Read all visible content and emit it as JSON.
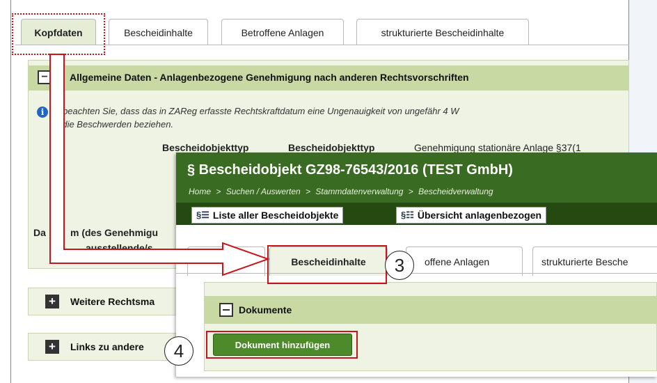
{
  "background": {
    "tabs": [
      {
        "label": "Kopfdaten",
        "active": true
      },
      {
        "label": "Bescheidinhalte",
        "active": false
      },
      {
        "label": "Betroffene Anlagen",
        "active": false
      },
      {
        "label": "strukturierte Bescheidinhalte",
        "active": false
      }
    ],
    "panel_title": "Allgemeine Daten - Anlagenbezogene Genehmigung nach anderen Rechtsvorschriften",
    "info_line1": "tte beachten Sie, dass das in ZAReg erfasste Rechtskraftdatum eine Ungenauigkeit von ungefähr 4 W",
    "info_line2": "ch die Beschwerden beziehen.",
    "field_label_1": "Bescheidobjekttyp",
    "field_label_2": "Bescheidobjekttyp",
    "field_value": "Genehmigung stationäre Anlage §37(1",
    "date_label": "m (des Genehmigu",
    "date_label_prefix": "Da",
    "issuer_label": "ausstellende/s",
    "sections": [
      {
        "label": "Weitere Rechtsma"
      },
      {
        "label": "Links zu andere"
      }
    ]
  },
  "overlay": {
    "title": "§ Bescheidobjekt GZ98-76543/2016 (TEST GmbH)",
    "breadcrumb": [
      "Home",
      ">",
      "Suchen / Auswerten",
      ">",
      "Stammdatenverwaltung",
      ">",
      "Bescheidverwaltung"
    ],
    "toolbar": [
      {
        "icon": "§☰",
        "label": "Liste aller Bescheidobjekte"
      },
      {
        "icon": "§☷",
        "label": "Übersicht anlagenbezogen"
      }
    ],
    "tabs": [
      {
        "label": "Bescheidinhalte",
        "active": true
      },
      {
        "label": "offene Anlagen",
        "active": false
      },
      {
        "label": "strukturierte Besche",
        "active": false
      }
    ],
    "section_title": "Dokumente",
    "add_button": "Dokument hinzufügen"
  },
  "annotations": {
    "step3": "3",
    "step4": "4",
    "highlight_color": "#c8151b"
  },
  "colors": {
    "header_green": "#3a6b22",
    "toolbar_green": "#244a12",
    "section_green": "#c9d9a4",
    "button_green": "#4d8a2a"
  }
}
